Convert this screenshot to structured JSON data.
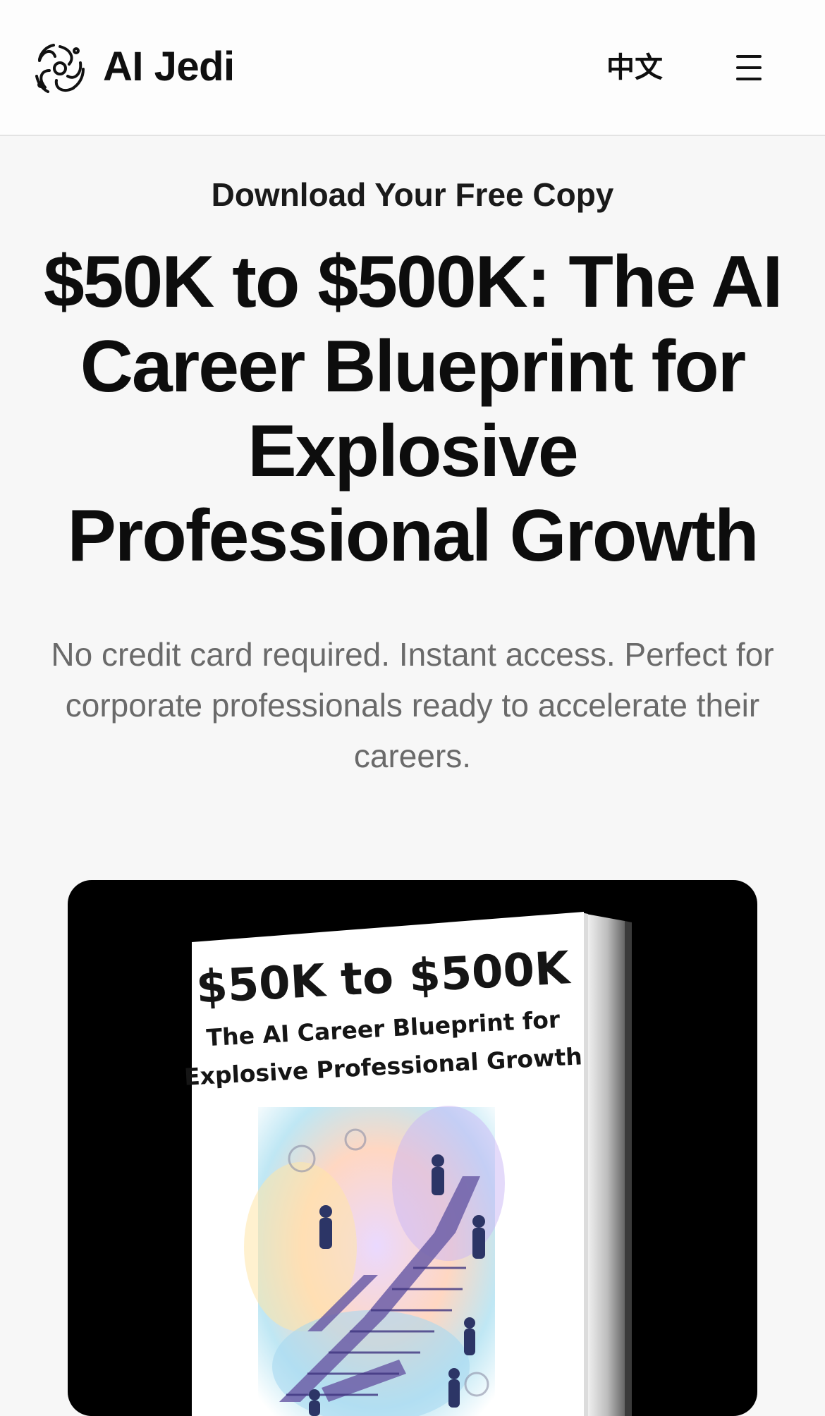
{
  "header": {
    "brand": "AI Jedi",
    "language_label": "中文",
    "logo_icon": "logo-icon",
    "menu_icon": "hamburger-menu-icon"
  },
  "hero": {
    "eyebrow": "Download Your Free Copy",
    "headline": "$50K to $500K: The AI Career Blueprint for Explosive Professional Growth",
    "subtext": "No credit card required. Instant access. Perfect for corporate professionals ready to accelerate their careers."
  },
  "book_cover": {
    "title": "$50K to $500K",
    "subtitle_line1": "The AI Career Blueprint for",
    "subtitle_line2": "Explosive Professional Growth"
  },
  "colors": {
    "background": "#f7f7f7",
    "header_background": "#fdfdfd",
    "text_primary": "#0f0f0f",
    "text_muted": "#6a6a6a",
    "card_background": "#000000"
  }
}
